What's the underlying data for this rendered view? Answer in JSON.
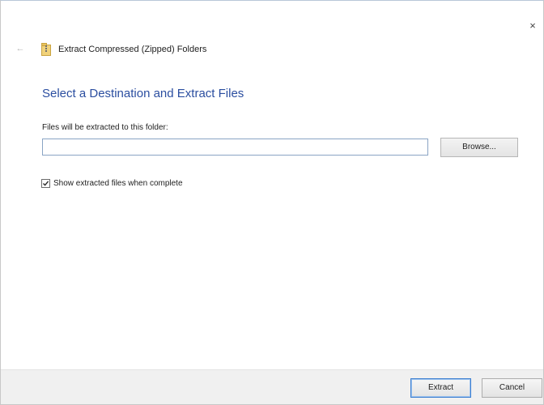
{
  "window": {
    "title": "Extract Compressed (Zipped) Folders",
    "close_glyph": "×",
    "back_glyph": "←"
  },
  "main": {
    "heading": "Select a Destination and Extract Files",
    "destination_label": "Files will be extracted to this folder:",
    "destination_value": "",
    "browse_label": "Browse...",
    "show_files_label": "Show extracted files when complete",
    "show_files_checked": true
  },
  "footer": {
    "extract_label": "Extract",
    "cancel_label": "Cancel"
  },
  "colors": {
    "heading": "#2b4ea0",
    "selection": "#3f7fd6",
    "focus_border": "#3c7fd1"
  },
  "icons": {
    "back": "arrow-left-icon",
    "title": "zip-folder-icon",
    "close": "close-icon",
    "check": "checkmark-icon"
  }
}
